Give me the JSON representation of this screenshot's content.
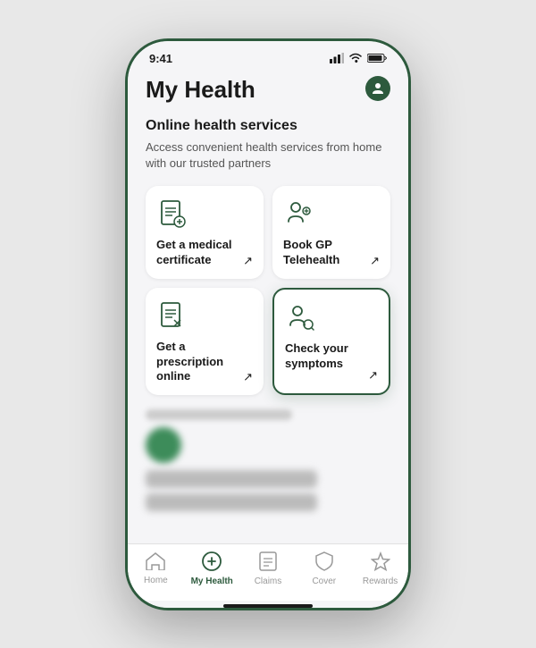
{
  "status_bar": {
    "time": "9:41"
  },
  "header": {
    "title": "My Health",
    "profile_icon": "👤"
  },
  "section": {
    "title": "Online health services",
    "subtitle": "Access convenient health services from home with our trusted partners"
  },
  "services": [
    {
      "id": "medical-certificate",
      "label": "Get a medical certificate",
      "icon": "medical-cert",
      "highlighted": false
    },
    {
      "id": "book-gp",
      "label": "Book GP Telehealth",
      "icon": "telehealth",
      "highlighted": false
    },
    {
      "id": "prescription",
      "label": "Get a prescription online",
      "icon": "prescription",
      "highlighted": false
    },
    {
      "id": "symptoms",
      "label": "Check your symptoms",
      "icon": "symptoms",
      "highlighted": true
    }
  ],
  "nav": {
    "items": [
      {
        "id": "home",
        "label": "Home",
        "active": false,
        "icon": "home"
      },
      {
        "id": "my-health",
        "label": "My Health",
        "active": true,
        "icon": "health"
      },
      {
        "id": "claims",
        "label": "Claims",
        "active": false,
        "icon": "claims"
      },
      {
        "id": "cover",
        "label": "Cover",
        "active": false,
        "icon": "cover"
      },
      {
        "id": "rewards",
        "label": "Rewards",
        "active": false,
        "icon": "rewards"
      }
    ]
  }
}
